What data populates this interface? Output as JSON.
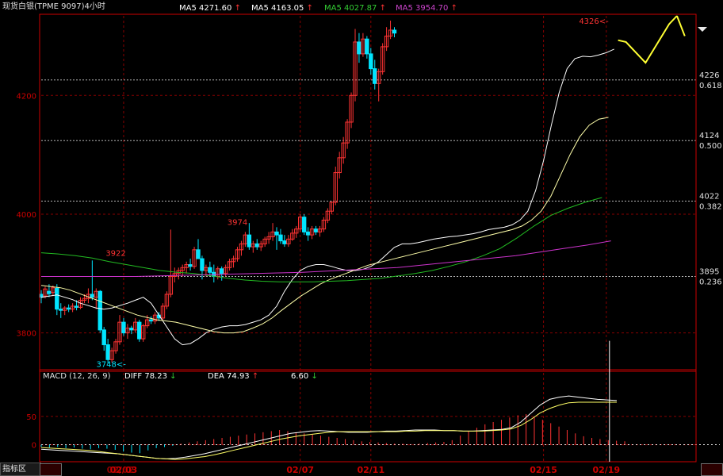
{
  "title": "现货白银(TPME 9097)4小时",
  "ma_legend": [
    {
      "label": "MA5 4271.60",
      "arrow": "↑",
      "color": "#ffffff"
    },
    {
      "label": "MA5 4163.05",
      "arrow": "↑",
      "color": "#ffffff"
    },
    {
      "label": "MA5 4027.87",
      "arrow": "↑",
      "color": "#33cc33"
    },
    {
      "label": "MA5 3954.70",
      "arrow": "↑",
      "color": "#cc44cc"
    }
  ],
  "macd_legend": {
    "name": "MACD (12, 26, 9)",
    "diff": "DIFF  78.23",
    "diff_arrow": "↓",
    "dea": "DEA  74.93",
    "dea_arrow": "↑",
    "macd": "6.60",
    "macd_arrow": "↓"
  },
  "tab_label": "指标区",
  "colors": {
    "up": "#ff3333",
    "down": "#00e5ff",
    "grid": "#880000",
    "axis": "#cc0000",
    "fib": "#d0d0d0",
    "forecast": "#ffff33"
  },
  "chart_data": [
    {
      "type": "candlestick",
      "title": "现货白银(TPME 9097)4小时",
      "ylim": [
        3738,
        4334
      ],
      "yticks": [
        3800,
        4000,
        4200
      ],
      "xticks": [
        {
          "index": 21,
          "label": "02/03"
        },
        {
          "index": 66,
          "label": "02/07"
        },
        {
          "index": 84,
          "label": "02/11"
        },
        {
          "index": 128,
          "label": "02/15"
        },
        {
          "index": 144,
          "label": "02/19"
        }
      ],
      "first_xtick_overprint": "02/02",
      "grid": true,
      "fibonacci": [
        {
          "value": 4226,
          "ratio": "0.618"
        },
        {
          "value": 4124,
          "ratio": "0.500"
        },
        {
          "value": 4022,
          "ratio": "0.382"
        },
        {
          "value": 3895,
          "ratio": "0.236"
        }
      ],
      "annotations": [
        {
          "label": "3922",
          "index": 19,
          "value": 3922
        },
        {
          "label": "3974",
          "index": 50,
          "value": 3974
        },
        {
          "label": "3748<-",
          "index": 22,
          "value": 3748
        },
        {
          "label": "4326<-",
          "index": 145,
          "value": 4326
        }
      ],
      "candles": [
        {
          "o": 3865,
          "h": 3872,
          "l": 3850,
          "c": 3860
        },
        {
          "o": 3862,
          "h": 3878,
          "l": 3858,
          "c": 3874
        },
        {
          "o": 3870,
          "h": 3882,
          "l": 3860,
          "c": 3866
        },
        {
          "o": 3868,
          "h": 3880,
          "l": 3862,
          "c": 3876
        },
        {
          "o": 3875,
          "h": 3882,
          "l": 3830,
          "c": 3840
        },
        {
          "o": 3840,
          "h": 3850,
          "l": 3825,
          "c": 3838
        },
        {
          "o": 3838,
          "h": 3845,
          "l": 3830,
          "c": 3842
        },
        {
          "o": 3842,
          "h": 3848,
          "l": 3835,
          "c": 3840
        },
        {
          "o": 3840,
          "h": 3850,
          "l": 3835,
          "c": 3845
        },
        {
          "o": 3845,
          "h": 3855,
          "l": 3838,
          "c": 3843
        },
        {
          "o": 3843,
          "h": 3860,
          "l": 3840,
          "c": 3855
        },
        {
          "o": 3855,
          "h": 3865,
          "l": 3850,
          "c": 3858
        },
        {
          "o": 3858,
          "h": 3875,
          "l": 3850,
          "c": 3865
        },
        {
          "o": 3865,
          "h": 3922,
          "l": 3855,
          "c": 3860
        },
        {
          "o": 3860,
          "h": 3875,
          "l": 3840,
          "c": 3870
        },
        {
          "o": 3870,
          "h": 3872,
          "l": 3800,
          "c": 3805
        },
        {
          "o": 3805,
          "h": 3810,
          "l": 3770,
          "c": 3780
        },
        {
          "o": 3780,
          "h": 3790,
          "l": 3748,
          "c": 3755
        },
        {
          "o": 3755,
          "h": 3775,
          "l": 3750,
          "c": 3770
        },
        {
          "o": 3770,
          "h": 3790,
          "l": 3765,
          "c": 3785
        },
        {
          "o": 3785,
          "h": 3830,
          "l": 3780,
          "c": 3818
        },
        {
          "o": 3818,
          "h": 3825,
          "l": 3795,
          "c": 3800
        },
        {
          "o": 3800,
          "h": 3815,
          "l": 3790,
          "c": 3808
        },
        {
          "o": 3808,
          "h": 3812,
          "l": 3798,
          "c": 3805
        },
        {
          "o": 3805,
          "h": 3825,
          "l": 3800,
          "c": 3818
        },
        {
          "o": 3818,
          "h": 3822,
          "l": 3785,
          "c": 3790
        },
        {
          "o": 3790,
          "h": 3815,
          "l": 3785,
          "c": 3812
        },
        {
          "o": 3812,
          "h": 3830,
          "l": 3808,
          "c": 3822
        },
        {
          "o": 3822,
          "h": 3828,
          "l": 3815,
          "c": 3820
        },
        {
          "o": 3820,
          "h": 3835,
          "l": 3815,
          "c": 3830
        },
        {
          "o": 3830,
          "h": 3835,
          "l": 3820,
          "c": 3825
        },
        {
          "o": 3825,
          "h": 3850,
          "l": 3822,
          "c": 3845
        },
        {
          "o": 3845,
          "h": 3870,
          "l": 3840,
          "c": 3865
        },
        {
          "o": 3865,
          "h": 3974,
          "l": 3860,
          "c": 3895
        },
        {
          "o": 3895,
          "h": 3910,
          "l": 3885,
          "c": 3900
        },
        {
          "o": 3900,
          "h": 3910,
          "l": 3890,
          "c": 3905
        },
        {
          "o": 3905,
          "h": 3915,
          "l": 3895,
          "c": 3910
        },
        {
          "o": 3910,
          "h": 3920,
          "l": 3900,
          "c": 3915
        },
        {
          "o": 3915,
          "h": 3925,
          "l": 3905,
          "c": 3912
        },
        {
          "o": 3912,
          "h": 3945,
          "l": 3908,
          "c": 3940
        },
        {
          "o": 3940,
          "h": 3958,
          "l": 3925,
          "c": 3925
        },
        {
          "o": 3925,
          "h": 3930,
          "l": 3890,
          "c": 3905
        },
        {
          "o": 3905,
          "h": 3915,
          "l": 3895,
          "c": 3910
        },
        {
          "o": 3910,
          "h": 3920,
          "l": 3895,
          "c": 3902
        },
        {
          "o": 3902,
          "h": 3915,
          "l": 3885,
          "c": 3895
        },
        {
          "o": 3895,
          "h": 3912,
          "l": 3890,
          "c": 3908
        },
        {
          "o": 3908,
          "h": 3912,
          "l": 3888,
          "c": 3900
        },
        {
          "o": 3900,
          "h": 3915,
          "l": 3895,
          "c": 3910
        },
        {
          "o": 3910,
          "h": 3925,
          "l": 3905,
          "c": 3920
        },
        {
          "o": 3920,
          "h": 3930,
          "l": 3910,
          "c": 3925
        },
        {
          "o": 3925,
          "h": 3945,
          "l": 3920,
          "c": 3940
        },
        {
          "o": 3940,
          "h": 3955,
          "l": 3930,
          "c": 3950
        },
        {
          "o": 3950,
          "h": 3970,
          "l": 3945,
          "c": 3965
        },
        {
          "o": 3965,
          "h": 3985,
          "l": 3940,
          "c": 3945
        },
        {
          "o": 3945,
          "h": 3955,
          "l": 3935,
          "c": 3950
        },
        {
          "o": 3950,
          "h": 3958,
          "l": 3940,
          "c": 3945
        },
        {
          "o": 3945,
          "h": 3955,
          "l": 3938,
          "c": 3950
        },
        {
          "o": 3950,
          "h": 3962,
          "l": 3945,
          "c": 3958
        },
        {
          "o": 3958,
          "h": 3970,
          "l": 3950,
          "c": 3962
        },
        {
          "o": 3962,
          "h": 3985,
          "l": 3955,
          "c": 3970
        },
        {
          "o": 3970,
          "h": 3978,
          "l": 3940,
          "c": 3965
        },
        {
          "o": 3965,
          "h": 3975,
          "l": 3950,
          "c": 3955
        },
        {
          "o": 3955,
          "h": 3965,
          "l": 3945,
          "c": 3950
        },
        {
          "o": 3950,
          "h": 3965,
          "l": 3945,
          "c": 3958
        },
        {
          "o": 3958,
          "h": 3975,
          "l": 3955,
          "c": 3968
        },
        {
          "o": 3968,
          "h": 3980,
          "l": 3960,
          "c": 3975
        },
        {
          "o": 3975,
          "h": 4000,
          "l": 3970,
          "c": 3995
        },
        {
          "o": 3995,
          "h": 4000,
          "l": 3965,
          "c": 3970
        },
        {
          "o": 3970,
          "h": 3978,
          "l": 3955,
          "c": 3965
        },
        {
          "o": 3965,
          "h": 3980,
          "l": 3958,
          "c": 3975
        },
        {
          "o": 3975,
          "h": 3980,
          "l": 3965,
          "c": 3970
        },
        {
          "o": 3970,
          "h": 3980,
          "l": 3962,
          "c": 3975
        },
        {
          "o": 3975,
          "h": 3995,
          "l": 3970,
          "c": 3990
        },
        {
          "o": 3990,
          "h": 4010,
          "l": 3985,
          "c": 4005
        },
        {
          "o": 4005,
          "h": 4022,
          "l": 4000,
          "c": 4020
        },
        {
          "o": 4020,
          "h": 4080,
          "l": 4015,
          "c": 4070
        },
        {
          "o": 4070,
          "h": 4105,
          "l": 4060,
          "c": 4095
        },
        {
          "o": 4095,
          "h": 4130,
          "l": 4085,
          "c": 4120
        },
        {
          "o": 4120,
          "h": 4160,
          "l": 4110,
          "c": 4155
        },
        {
          "o": 4155,
          "h": 4205,
          "l": 4145,
          "c": 4200
        },
        {
          "o": 4200,
          "h": 4312,
          "l": 4190,
          "c": 4290
        },
        {
          "o": 4290,
          "h": 4305,
          "l": 4255,
          "c": 4270
        },
        {
          "o": 4270,
          "h": 4305,
          "l": 4265,
          "c": 4295
        },
        {
          "o": 4295,
          "h": 4300,
          "l": 4262,
          "c": 4270
        },
        {
          "o": 4270,
          "h": 4280,
          "l": 4235,
          "c": 4245
        },
        {
          "o": 4245,
          "h": 4260,
          "l": 4210,
          "c": 4220
        },
        {
          "o": 4220,
          "h": 4245,
          "l": 4190,
          "c": 4240
        },
        {
          "o": 4240,
          "h": 4288,
          "l": 4235,
          "c": 4282
        },
        {
          "o": 4282,
          "h": 4315,
          "l": 4275,
          "c": 4300
        },
        {
          "o": 4300,
          "h": 4326,
          "l": 4295,
          "c": 4310
        },
        {
          "o": 4310,
          "h": 4315,
          "l": 4298,
          "c": 4305
        }
      ],
      "ma_white": [
        3860,
        3862,
        3864,
        3860,
        3856,
        3850,
        3846,
        3842,
        3840,
        3842,
        3846,
        3850,
        3855,
        3860,
        3850,
        3830,
        3810,
        3790,
        3780,
        3782,
        3790,
        3800,
        3806,
        3810,
        3812,
        3812,
        3814,
        3818,
        3822,
        3830,
        3845,
        3870,
        3890,
        3905,
        3912,
        3915,
        3915,
        3912,
        3908,
        3905,
        3905,
        3907,
        3912,
        3920,
        3932,
        3944,
        3950,
        3950,
        3952,
        3955,
        3958,
        3960,
        3962,
        3963,
        3965,
        3967,
        3970,
        3974,
        3976,
        3978,
        3982,
        3990,
        4005,
        4040,
        4090,
        4150,
        4205,
        4245,
        4262,
        4266,
        4265,
        4268,
        4272,
        4278
      ],
      "ma_yellow": [
        3880,
        3878,
        3876,
        3872,
        3866,
        3860,
        3854,
        3848,
        3842,
        3836,
        3830,
        3826,
        3822,
        3820,
        3818,
        3814,
        3810,
        3806,
        3802,
        3800,
        3800,
        3802,
        3808,
        3815,
        3825,
        3838,
        3850,
        3862,
        3872,
        3882,
        3890,
        3896,
        3902,
        3908,
        3914,
        3918,
        3922,
        3926,
        3930,
        3934,
        3938,
        3942,
        3946,
        3950,
        3954,
        3958,
        3962,
        3966,
        3970,
        3974,
        3980,
        3990,
        4005,
        4030,
        4065,
        4100,
        4130,
        4150,
        4160,
        4163
      ],
      "ma_green": [
        3935,
        3933,
        3930,
        3926,
        3920,
        3915,
        3910,
        3905,
        3902,
        3900,
        3896,
        3892,
        3889,
        3887,
        3886,
        3886,
        3886,
        3887,
        3888,
        3890,
        3892,
        3896,
        3900,
        3905,
        3912,
        3920,
        3930,
        3942,
        3960,
        3980,
        3998,
        4010,
        4020,
        4028
      ],
      "ma_magenta": [
        3895,
        3895,
        3895,
        3895,
        3895,
        3896,
        3897,
        3898,
        3899,
        3900,
        3901,
        3902,
        3904,
        3906,
        3908,
        3910,
        3914,
        3918,
        3922,
        3926,
        3930,
        3936,
        3942,
        3948,
        3955
      ],
      "forecast_path": [
        [
          4293
        ],
        [
          4312,
          4290
        ],
        [
          4325,
          4255
        ],
        [
          4305,
          4320
        ],
        [
          4334,
          4300
        ]
      ]
    },
    {
      "type": "bar",
      "title": "MACD (12, 26, 9)",
      "ylim": [
        -30,
        110
      ],
      "yticks": [
        0,
        50
      ],
      "series": [
        {
          "name": "DIFF",
          "values": [
            -8,
            -9,
            -10,
            -11,
            -12,
            -13,
            -14,
            -15,
            -16,
            -18,
            -20,
            -22,
            -24,
            -25,
            -24,
            -22,
            -19,
            -16,
            -12,
            -8,
            -4,
            0,
            4,
            8,
            12,
            16,
            20,
            22,
            24,
            25,
            24,
            23,
            22,
            22,
            22,
            23,
            24,
            24,
            25,
            26,
            26,
            26,
            25,
            25,
            24,
            24,
            25,
            26,
            27,
            30,
            40,
            55,
            70,
            80,
            84,
            86,
            84,
            82,
            80,
            79,
            78
          ]
        },
        {
          "name": "DEA",
          "values": [
            -5,
            -6,
            -7,
            -8,
            -9,
            -10,
            -12,
            -14,
            -16,
            -18,
            -20,
            -22,
            -24,
            -25,
            -26,
            -25,
            -23,
            -21,
            -18,
            -14,
            -10,
            -6,
            -2,
            2,
            6,
            10,
            13,
            16,
            18,
            20,
            22,
            23,
            23,
            23,
            23,
            23,
            23,
            23,
            24,
            24,
            25,
            25,
            25,
            25,
            24,
            24,
            24,
            25,
            26,
            28,
            34,
            44,
            56,
            64,
            70,
            74,
            75,
            75,
            75,
            75,
            75
          ]
        },
        {
          "name": "MACD",
          "values": [
            -4,
            -5,
            -4,
            -6,
            -5,
            -7,
            -8,
            -6,
            -7,
            -9,
            -12,
            -14,
            -15,
            -10,
            -6,
            -4,
            -2,
            2,
            4,
            6,
            8,
            10,
            12,
            14,
            16,
            18,
            20,
            22,
            24,
            26,
            24,
            22,
            20,
            18,
            16,
            14,
            12,
            10,
            8,
            6,
            5,
            4,
            3,
            2,
            2,
            1,
            2,
            3,
            4,
            5,
            8,
            16,
            24,
            30,
            36,
            40,
            44,
            48,
            52,
            54,
            50,
            44,
            38,
            32,
            26,
            20,
            15,
            12,
            10,
            8,
            7,
            6
          ]
        }
      ]
    }
  ]
}
